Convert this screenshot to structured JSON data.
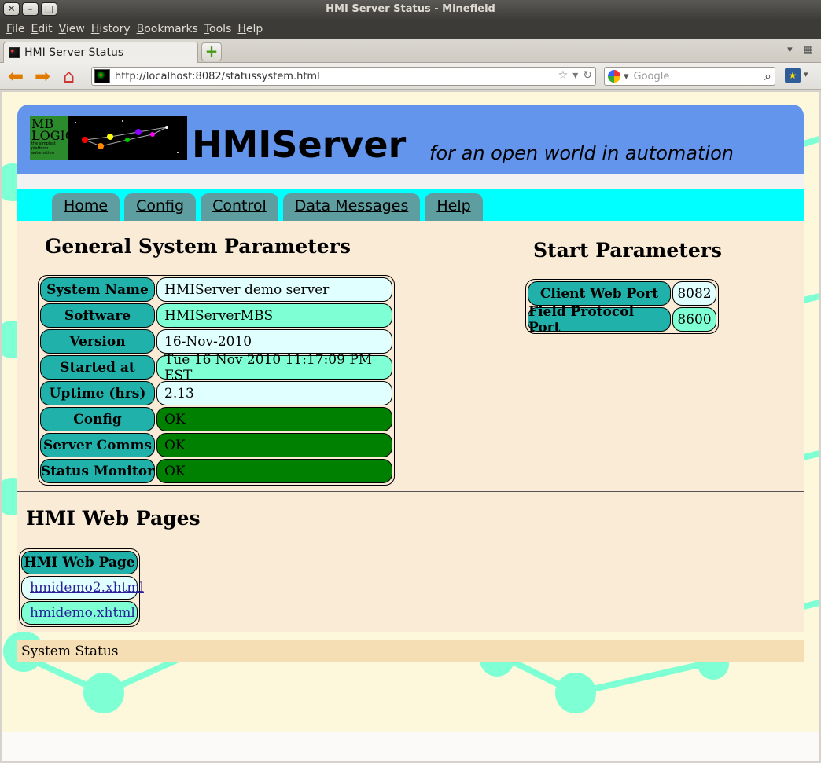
{
  "window": {
    "title": "HMI Server Status - Minefield"
  },
  "menu": [
    "File",
    "Edit",
    "View",
    "History",
    "Bookmarks",
    "Tools",
    "Help"
  ],
  "browser": {
    "tab_title": "HMI Server Status",
    "url": "http://localhost:8082/statussystem.html",
    "search_placeholder": "Google"
  },
  "header": {
    "logo_text": "MB LOGIC",
    "logo_small": "the simplest platform automation",
    "title": "HMIServer",
    "tagline": "for an open world in automation"
  },
  "nav": [
    "Home",
    "Config",
    "Control",
    "Data Messages",
    "Help"
  ],
  "general": {
    "title": "General System Parameters",
    "rows": [
      {
        "label": "System Name",
        "value": "HMIServer demo server",
        "style": "light"
      },
      {
        "label": "Software",
        "value": "HMIServerMBS",
        "style": "aqua"
      },
      {
        "label": "Version",
        "value": "16-Nov-2010",
        "style": "light"
      },
      {
        "label": "Started at",
        "value": "Tue 16 Nov 2010 11:17:09 PM EST",
        "style": "aqua"
      },
      {
        "label": "Uptime (hrs)",
        "value": "2.13",
        "style": "light"
      },
      {
        "label": "Config",
        "value": "OK",
        "style": "ok"
      },
      {
        "label": "Server Comms",
        "value": "OK",
        "style": "ok"
      },
      {
        "label": "Status Monitor",
        "value": "OK",
        "style": "ok"
      }
    ]
  },
  "start": {
    "title": "Start Parameters",
    "rows": [
      {
        "label": "Client Web Port",
        "value": "8082",
        "style": "light"
      },
      {
        "label": "Field Protocol Port",
        "value": "8600",
        "style": "aqua"
      }
    ]
  },
  "web_pages": {
    "title": "HMI Web Pages",
    "header": "HMI Web Page",
    "links": [
      {
        "text": "hmidemo2.xhtml",
        "style": "light"
      },
      {
        "text": "hmidemo.xhtml",
        "style": "aqua"
      }
    ]
  },
  "status_strip": "System Status",
  "colors": {
    "header": "#6495ed",
    "nav": "#00ffff",
    "tab": "#5f9ea0",
    "cell_header": "#20b2aa",
    "ok": "#008000",
    "page_bg": "#faebd7"
  }
}
